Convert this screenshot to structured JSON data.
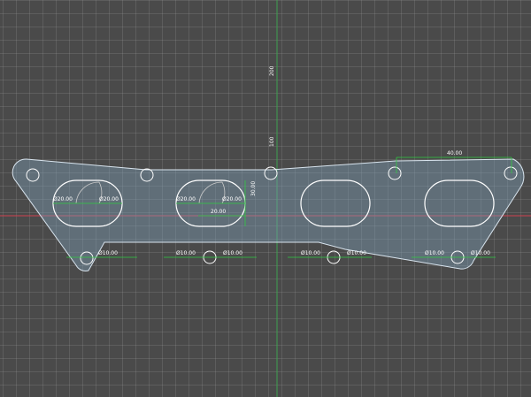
{
  "colors": {
    "background": "#4a4a4a",
    "grid_minor": "#5a5a5a",
    "axis_x": "#d04050",
    "axis_y": "#3fa050",
    "profile_fill": "#7f9fb8",
    "profile_stroke": "#d8e4ee",
    "dimension": "#2ecc40",
    "construction": "#cccccc"
  },
  "ruler": {
    "y_200": "200",
    "y_100": "100"
  },
  "dimensions": {
    "port1_left": "Ø20.00",
    "port1_right": "Ø20.00",
    "port2_left": "Ø20.00",
    "port2_right": "Ø20.00",
    "port2_height": "30.00",
    "port2_width": "20.00",
    "bottom_bolt_1": "Ø10.00",
    "bottom_bolt_2": "Ø10.00",
    "bottom_bolt_3": "Ø10.00",
    "bottom_bolt_4": "Ø10.00",
    "bottom_bolt_5": "Ø10.00",
    "bottom_bolt_6": "Ø10.00",
    "bottom_bolt_7": "Ø10.00",
    "top_right": "40.00"
  }
}
